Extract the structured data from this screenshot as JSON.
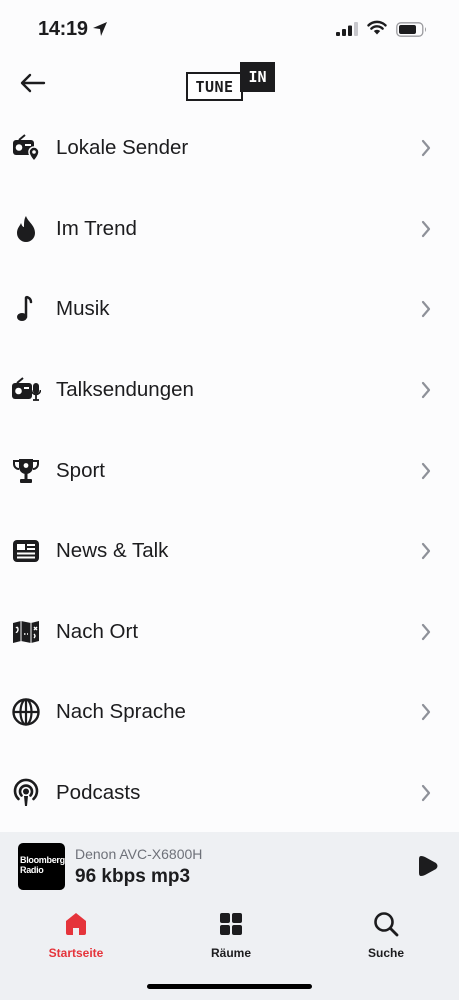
{
  "status_bar": {
    "time": "14:19"
  },
  "header": {
    "logo_tune": "TUNE",
    "logo_in": "IN"
  },
  "menu": {
    "items": [
      {
        "label": "Lokale Sender",
        "icon": "local-radio-icon"
      },
      {
        "label": "Im Trend",
        "icon": "flame-icon"
      },
      {
        "label": "Musik",
        "icon": "music-note-icon"
      },
      {
        "label": "Talksendungen",
        "icon": "talk-radio-icon"
      },
      {
        "label": "Sport",
        "icon": "trophy-icon"
      },
      {
        "label": "News & Talk",
        "icon": "newspaper-icon"
      },
      {
        "label": "Nach Ort",
        "icon": "map-icon"
      },
      {
        "label": "Nach Sprache",
        "icon": "globe-icon"
      },
      {
        "label": "Podcasts",
        "icon": "podcast-icon"
      }
    ]
  },
  "player": {
    "artwork_line1": "Bloomberg",
    "artwork_line2": "Radio",
    "device": "Denon AVC-X6800H",
    "quality": "96 kbps mp3"
  },
  "tabbar": {
    "tabs": [
      {
        "label": "Startseite",
        "icon": "home-icon",
        "active": true
      },
      {
        "label": "Räume",
        "icon": "rooms-grid-icon",
        "active": false
      },
      {
        "label": "Suche",
        "icon": "search-icon",
        "active": false
      }
    ]
  },
  "colors": {
    "accent": "#e5343b",
    "background": "#fcfcfd",
    "player_bg": "#eef0f3",
    "text": "#1c1c1e",
    "secondary_text": "#6e7179",
    "chevron": "#8e9199"
  }
}
